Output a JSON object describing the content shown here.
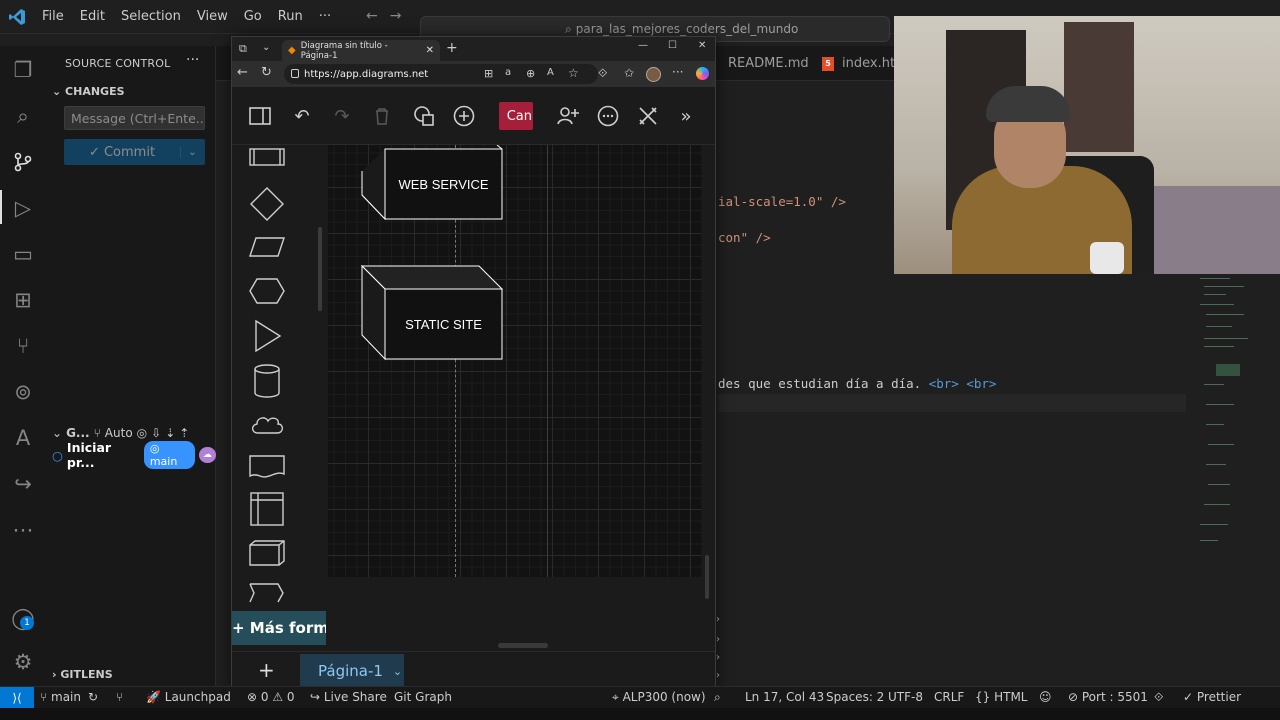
{
  "vscode": {
    "menu": [
      "File",
      "Edit",
      "Selection",
      "View",
      "Go",
      "Run",
      "···"
    ],
    "search_text": "para_las_mejores_coders_del_mundo",
    "sidebar": {
      "title": "SOURCE CONTROL",
      "changes_label": "CHANGES",
      "message_placeholder": "Message (Ctrl+Ente...",
      "commit_label": "✓ Commit",
      "graph_label": "G...",
      "graph_auto": "Auto",
      "iniciar_label": "Iniciar pr...",
      "branch_pill": "main",
      "gitlens_label": "GITLENS",
      "accounts_badge": "1"
    },
    "tabs": [
      {
        "label": "README.md"
      },
      {
        "label": "index.htm"
      }
    ],
    "code": {
      "line1": "ial-scale=1.0\" />",
      "line2": "con\" />",
      "line3_text": "des que estudian día a día. ",
      "line3_tag1": "<br>",
      "line3_tag2": "<br>"
    },
    "statusbar": {
      "branch": "main",
      "launchpad": "Launchpad",
      "problems": "⊗ 0 ⚠ 0",
      "live_share": "Live Share",
      "git_graph": "Git Graph",
      "alp": "ALP300 (now)",
      "position": "Ln 17, Col 43",
      "spaces": "Spaces: 2",
      "encoding": "UTF-8",
      "eol": "CRLF",
      "language": "HTML",
      "port": "Port : 5501",
      "prettier": "Prettier"
    }
  },
  "browser": {
    "tab_title": "Diagrama sin título - Página-1",
    "url": "https://app.diagrams.net"
  },
  "drawio": {
    "toolbar_can_label": "Can",
    "nodes": [
      {
        "label": "WEB SERVICE"
      },
      {
        "label": "STATIC SITE"
      }
    ],
    "more_shapes": "+ Más formas",
    "page_tab": "Página-1"
  },
  "colors": {
    "accent": "#0078d4",
    "can_button": "#a51e3a",
    "page_tab_bg": "#1f3b4d",
    "branch_pill": "#3794ff"
  }
}
